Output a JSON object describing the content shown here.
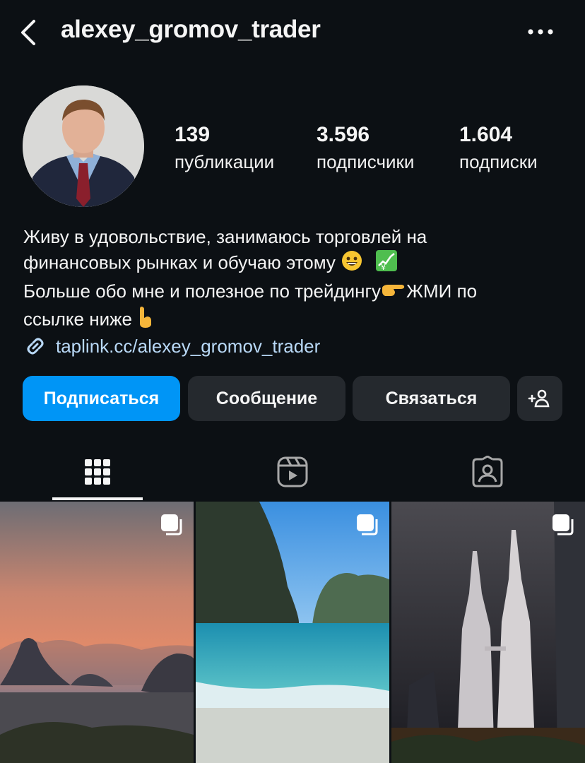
{
  "header": {
    "username": "alexey_gromov_trader",
    "back_icon": "chevron-left-icon",
    "more_icon": "more-horizontal-icon"
  },
  "stats": [
    {
      "value": "139",
      "label": "публикации"
    },
    {
      "value": "3.596",
      "label": "подписчики"
    },
    {
      "value": "1.604",
      "label": "подписки"
    }
  ],
  "bio": {
    "line1": "Живу в удовольствие, занимаюсь торговлей на",
    "line2": "финансовых рынках и обучаю этому",
    "line3": "Больше обо мне и полезное по трейдингу",
    "line3b": "ЖМИ по",
    "line4": "ссылке ниже",
    "emoji_grin": "😀",
    "emoji_chart": "💹",
    "emoji_point_right": "👉",
    "emoji_point_down": "👇"
  },
  "link": {
    "text": "taplink.cc/alexey_gromov_trader",
    "icon": "link-icon"
  },
  "buttons": {
    "follow": "Подписаться",
    "message": "Сообщение",
    "contact": "Связаться",
    "add_person_icon": "add-person-icon"
  },
  "tabs": [
    {
      "icon": "grid-icon",
      "selected": true
    },
    {
      "icon": "reels-icon",
      "selected": false
    },
    {
      "icon": "tagged-icon",
      "selected": false
    }
  ],
  "posts": [
    {
      "subject": "sunset-islands",
      "carousel": true
    },
    {
      "subject": "beach-cliffs",
      "carousel": true
    },
    {
      "subject": "petronas-towers",
      "carousel": true
    }
  ],
  "colors": {
    "background": "#0c1014",
    "accent": "#0095f6",
    "button_gray": "#25292e",
    "link": "#b9d9f7"
  }
}
